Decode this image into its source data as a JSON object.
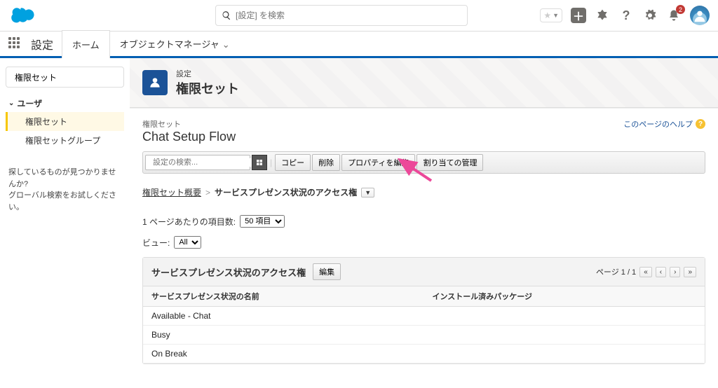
{
  "header": {
    "search_placeholder": "[設定] を検索",
    "fav_label": "★",
    "notification_count": "2"
  },
  "context": {
    "app_title": "設定",
    "tab_home": "ホーム",
    "tab_object_manager": "オブジェクトマネージャ"
  },
  "sidebar": {
    "search_value": "権限セット",
    "group_users": "ユーザ",
    "items": [
      {
        "label": "権限セット",
        "active": true
      },
      {
        "label": "権限セットグループ",
        "active": false
      }
    ],
    "help_line1": "探しているものが見つかりませんか?",
    "help_line2": "グローバル検索をお試しください。"
  },
  "mast": {
    "eyebrow": "設定",
    "title": "権限セット"
  },
  "page": {
    "eyebrow": "権限セット",
    "title": "Chat Setup Flow",
    "help_link": "このページのヘルプ"
  },
  "toolbar": {
    "search_placeholder": "設定の検索...",
    "copy": "コピー",
    "delete": "削除",
    "edit_props": "プロパティを編集",
    "manage_assign": "割り当ての管理"
  },
  "breadcrumb": {
    "root": "権限セット概要",
    "current": "サービスプレゼンス状況のアクセス権"
  },
  "list_options": {
    "items_per_page_label": "1 ページあたりの項目数:",
    "items_per_page_value": "50 項目",
    "view_label": "ビュー:",
    "view_value": "All"
  },
  "panel": {
    "title": "サービスプレゼンス状況のアクセス権",
    "edit_btn": "編集",
    "page_info": "ページ 1 / 1",
    "col_name": "サービスプレゼンス状況の名前",
    "col_package": "インストール済みパッケージ",
    "rows": [
      {
        "name": "Available - Chat",
        "pkg": ""
      },
      {
        "name": "Busy",
        "pkg": ""
      },
      {
        "name": "On Break",
        "pkg": ""
      }
    ]
  }
}
